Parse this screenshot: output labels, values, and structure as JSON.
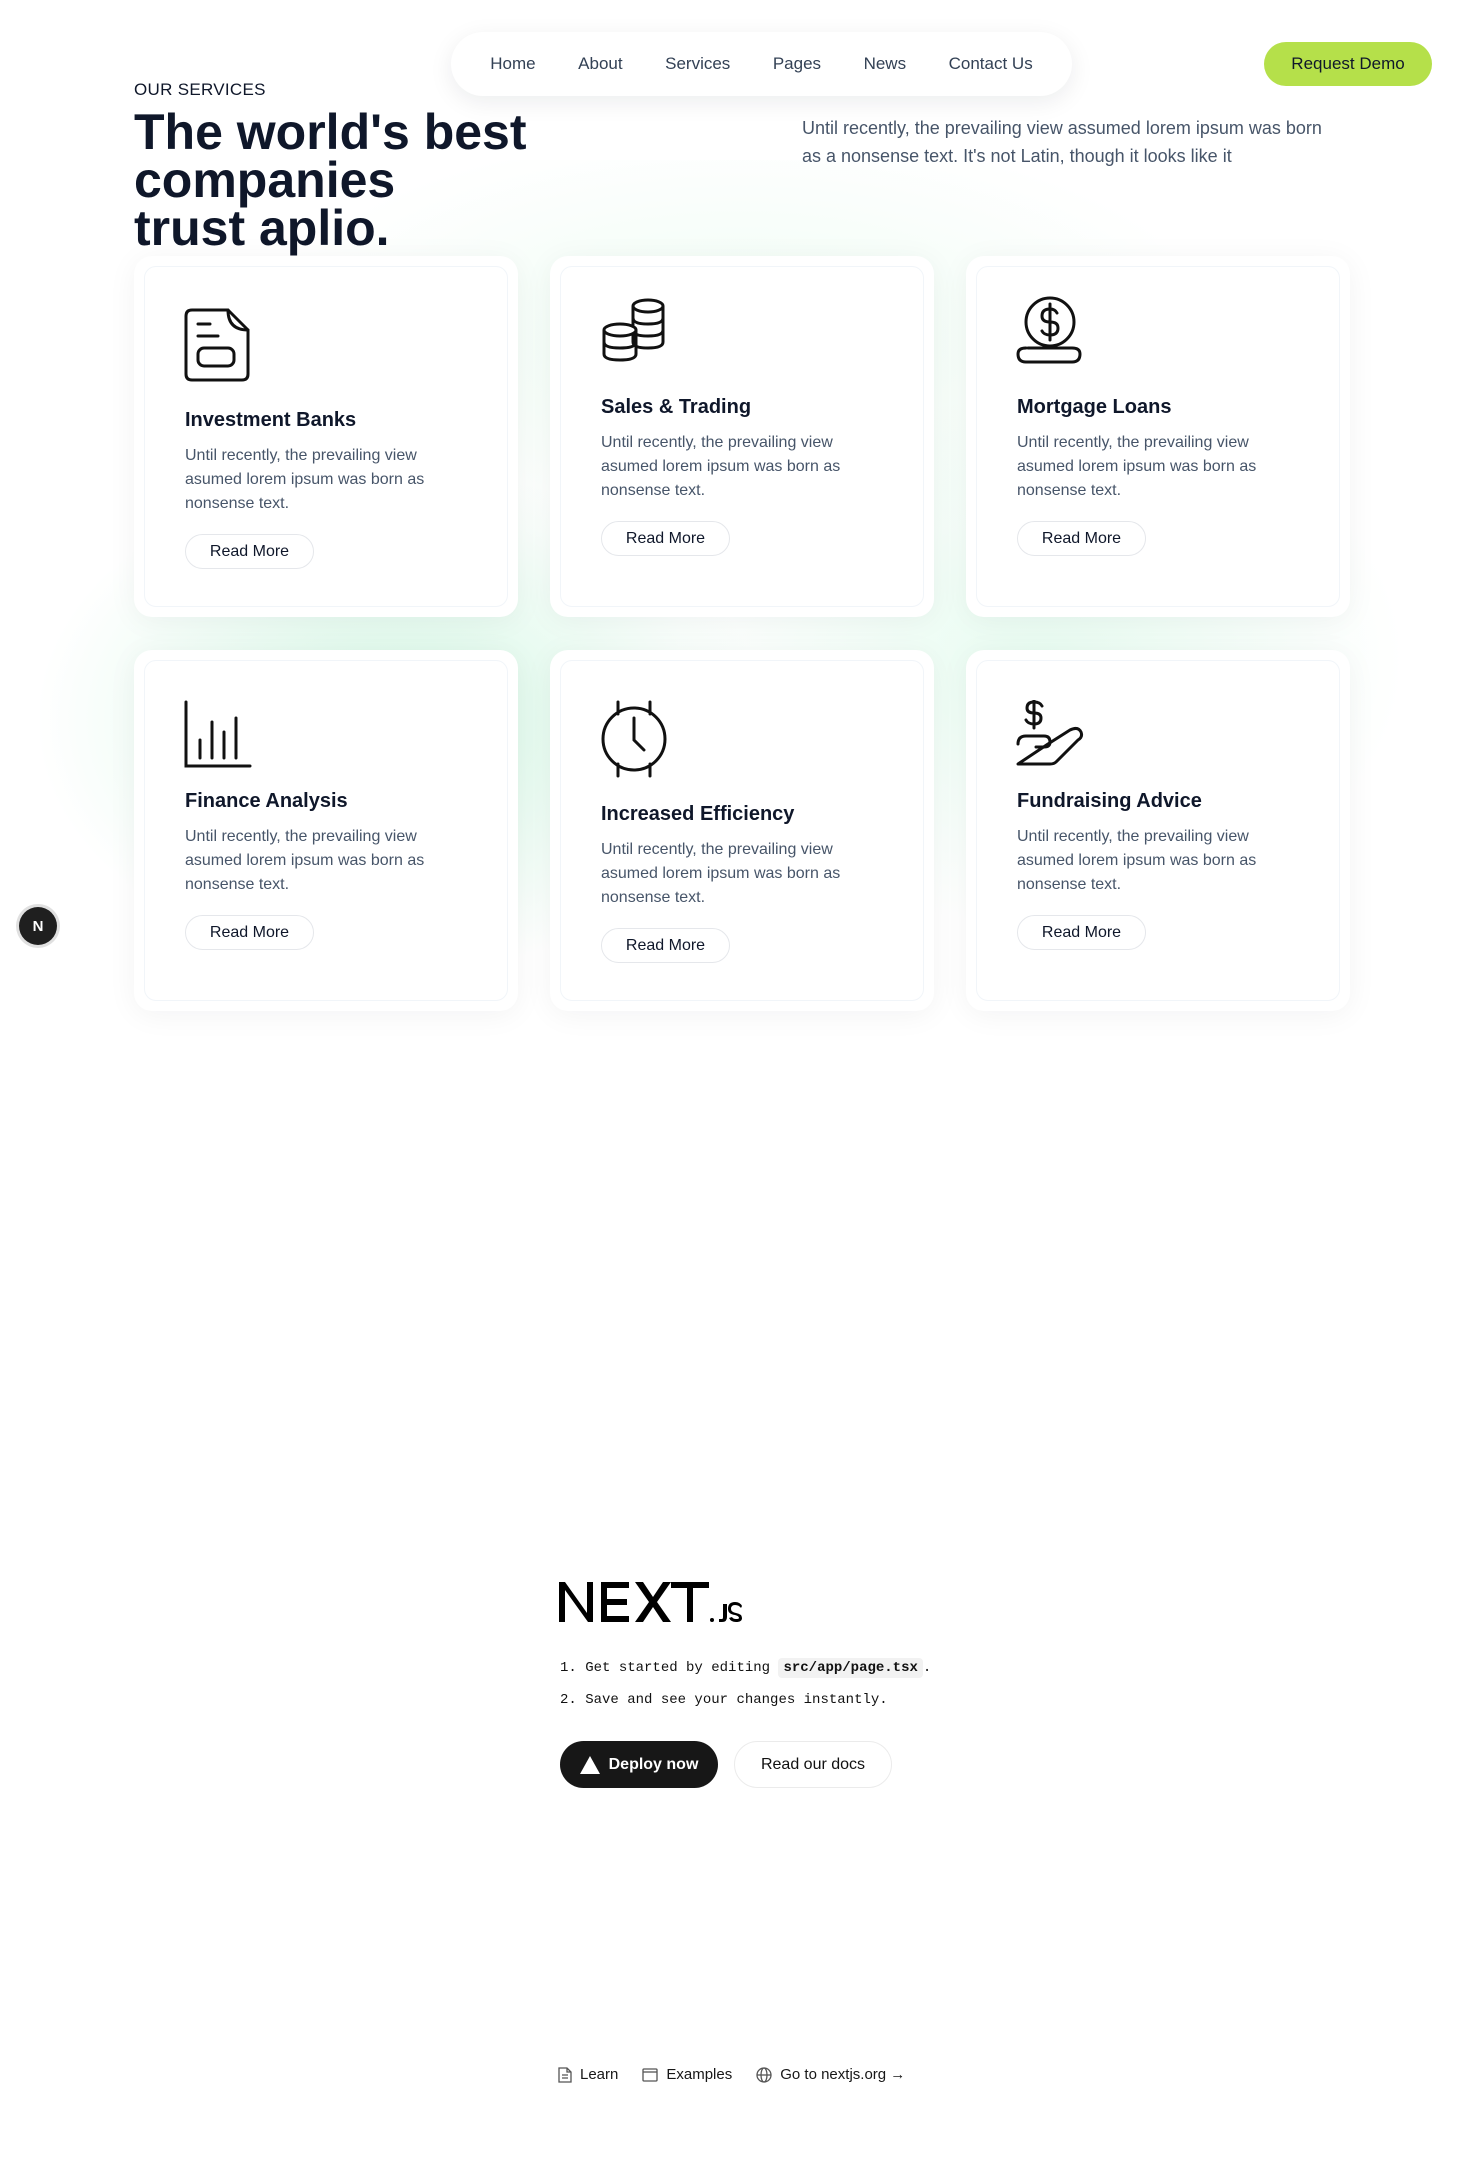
{
  "nav": {
    "items": [
      "Home",
      "About",
      "Services",
      "Pages",
      "News",
      "Contact Us"
    ],
    "cta_label": "Request Demo"
  },
  "hero": {
    "eyebrow": "OUR SERVICES",
    "title_line1": "The world's best companies",
    "title_line2": "trust aplio.",
    "description": "Until recently, the prevailing view assumed lorem ipsum was born as a nonsense text. It's not Latin, though it looks like it"
  },
  "services": [
    {
      "title": "Investment Banks",
      "text": "Until recently, the prevailing view asumed lorem ipsum was born as nonsense text.",
      "button": "Read More",
      "icon": "document-icon"
    },
    {
      "title": "Sales & Trading",
      "text": "Until recently, the prevailing view asumed lorem ipsum was born as nonsense text.",
      "button": "Read More",
      "icon": "coins-icon"
    },
    {
      "title": "Mortgage Loans",
      "text": "Until recently, the prevailing view asumed lorem ipsum was born as nonsense text.",
      "button": "Read More",
      "icon": "dollar-coin-hand-icon"
    },
    {
      "title": "Finance Analysis",
      "text": "Until recently, the prevailing view asumed lorem ipsum was born as nonsense text.",
      "button": "Read More",
      "icon": "bar-chart-icon"
    },
    {
      "title": "Increased Efficiency",
      "text": "Until recently, the prevailing view asumed lorem ipsum was born as nonsense text.",
      "button": "Read More",
      "icon": "stopwatch-icon"
    },
    {
      "title": "Fundraising Advice",
      "text": "Until recently, the prevailing view asumed lorem ipsum was born as nonsense text.",
      "button": "Read More",
      "icon": "hand-dollar-icon"
    }
  ],
  "dev_badge": {
    "letter": "N"
  },
  "nextjs": {
    "logo_text": "NEXT.js",
    "step1_prefix": "Get started by editing",
    "step1_code": "src/app/page.tsx",
    "step1_suffix": ".",
    "step2": "Save and see your changes instantly.",
    "deploy_label": "Deploy now",
    "docs_label": "Read our docs"
  },
  "footer": {
    "learn": "Learn",
    "examples": "Examples",
    "nextjs_org": "Go to nextjs.org →"
  }
}
